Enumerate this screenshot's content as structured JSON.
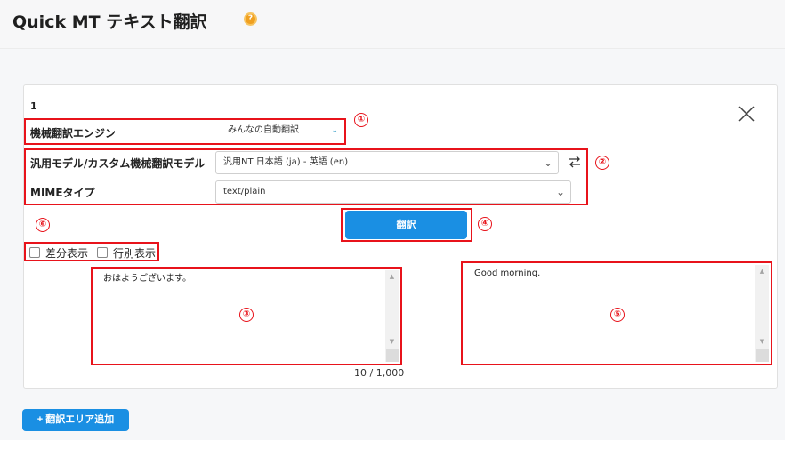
{
  "app": {
    "title": "Quick MT テキスト翻訳",
    "help_icon": "question-circle-icon",
    "help_glyph": "?"
  },
  "card": {
    "number": "1",
    "close_icon": "close-icon",
    "engine_label": "機械翻訳エンジン",
    "engine_value": "みんなの自動翻訳",
    "model_label": "汎用モデル/カスタム機械翻訳モデル",
    "model_value": "汎用NT 日本語 (ja) - 英語 (en)",
    "swap_icon": "swap-arrows-icon",
    "mime_label": "MIMEタイプ",
    "mime_value": "text/plain",
    "translate_label": "翻訳",
    "options": {
      "diff_label": "差分表示",
      "line_label": "行別表示"
    },
    "source_text": "おはようございます。",
    "target_text": "Good morning.",
    "counter": "10 / 1,000"
  },
  "add_area_label": "+ 翻訳エリア追加",
  "markers": [
    "①",
    "②",
    "③",
    "④",
    "⑤",
    "⑥"
  ],
  "colors": {
    "accent": "#1a8fe3",
    "annotation_red": "#e8131b",
    "help_icon": "#f0a020"
  }
}
